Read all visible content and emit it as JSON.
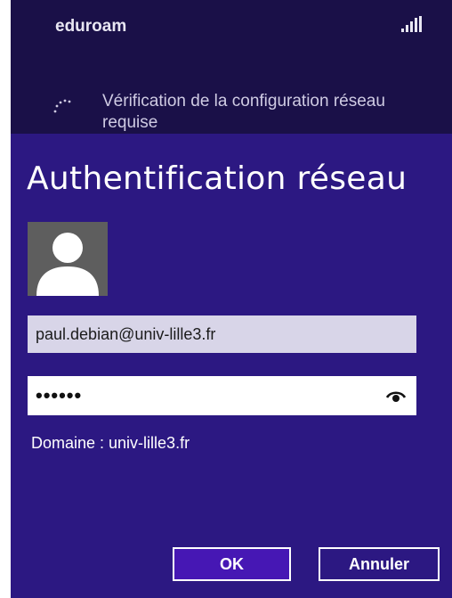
{
  "network": {
    "name": "eduroam",
    "signal_icon": "signal-bars-icon",
    "status_icon": "spinner-icon",
    "status_text": "Vérification de la configuration réseau requise"
  },
  "dialog": {
    "title": "Authentification réseau",
    "avatar_icon": "user-avatar-icon",
    "username_value": "paul.debian@univ-lille3.fr",
    "password_masked": "••••••",
    "reveal_icon": "eye-icon",
    "domain_text": "Domaine : univ-lille3.fr",
    "ok_label": "OK",
    "cancel_label": "Annuler"
  },
  "colors": {
    "background_top": "#1a1048",
    "dialog_background": "#2c1882",
    "primary_button": "#4617b4",
    "input_background": "#d8d5e8"
  }
}
